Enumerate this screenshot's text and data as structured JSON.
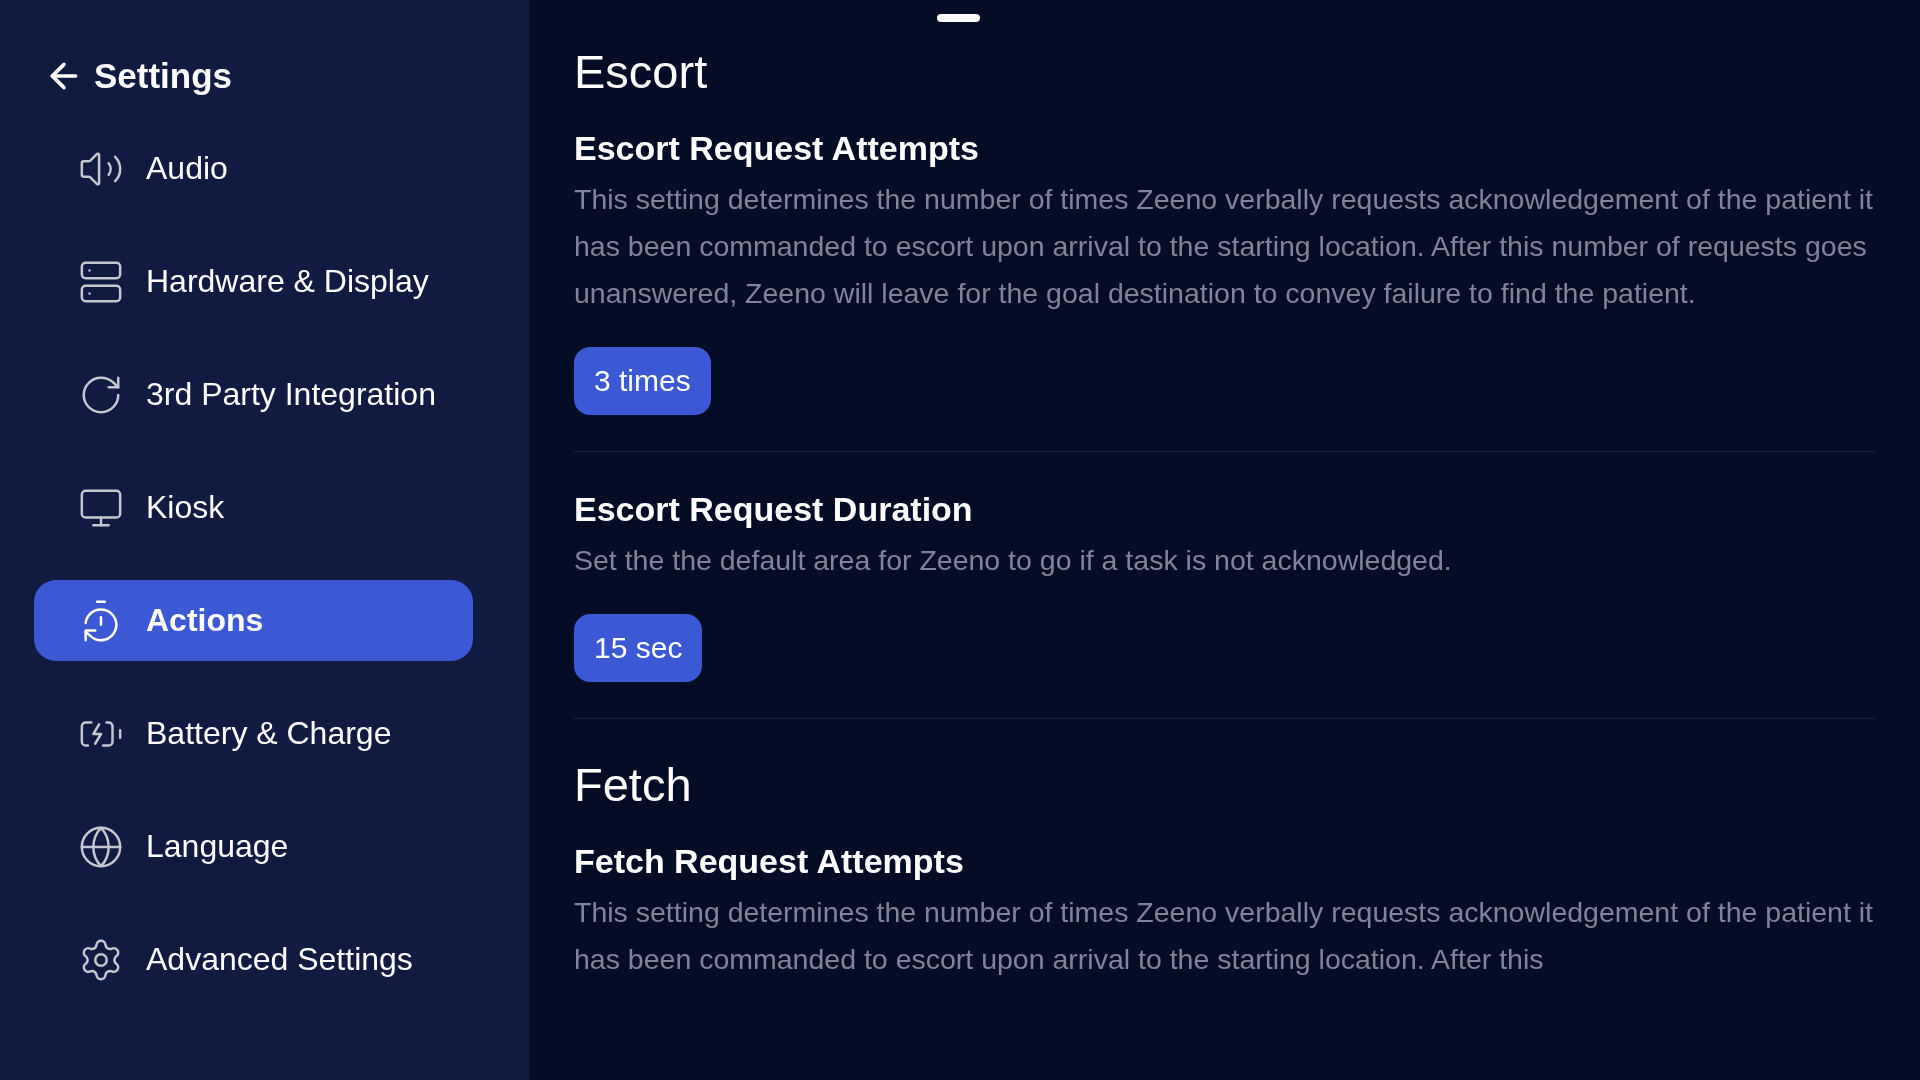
{
  "sidebar": {
    "back_label": "Settings",
    "items": [
      {
        "label": "Audio",
        "selected": false
      },
      {
        "label": "Hardware & Display",
        "selected": false
      },
      {
        "label": "3rd Party Integration",
        "selected": false
      },
      {
        "label": "Kiosk",
        "selected": false
      },
      {
        "label": "Actions",
        "selected": true
      },
      {
        "label": "Battery & Charge",
        "selected": false
      },
      {
        "label": "Language",
        "selected": false
      },
      {
        "label": "Advanced Settings",
        "selected": false
      }
    ]
  },
  "sections": [
    {
      "heading": "Escort",
      "settings": [
        {
          "title": "Escort Request Attempts",
          "description": "This setting determines the number of times Zeeno verbally requests acknowledgement of the patient it has been commanded to escort upon arrival to the starting location. After this number of requests goes unanswered, Zeeno will leave for the goal destination to convey failure to find the patient.",
          "value": "3 times"
        },
        {
          "title": "Escort Request Duration",
          "description": "Set the the default area for Zeeno to go if a task is not acknowledged.",
          "value": "15 sec"
        }
      ]
    },
    {
      "heading": "Fetch",
      "settings": [
        {
          "title": "Fetch Request Attempts",
          "description": "This setting determines the number of times Zeeno verbally requests acknowledgement of the patient it has been commanded to escort upon arrival to the starting location. After this"
        }
      ]
    }
  ]
}
